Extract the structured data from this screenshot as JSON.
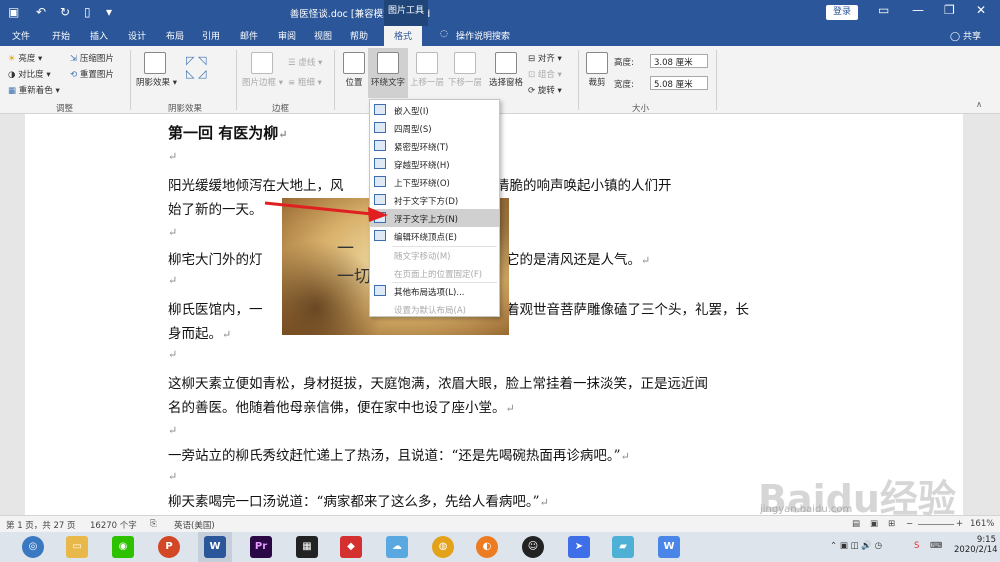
{
  "titlebar": {
    "title": "善医怪谈.doc [兼容模式] - Word",
    "context_tool": "图片工具",
    "login": "登录"
  },
  "tabs": [
    "文件",
    "开始",
    "插入",
    "设计",
    "布局",
    "引用",
    "邮件",
    "审阅",
    "视图",
    "帮助",
    "格式",
    "操作说明搜索",
    "共享"
  ],
  "ribbon": {
    "adjust": {
      "brightness": "亮度",
      "contrast": "对比度",
      "recolor": "重新着色",
      "compress": "压缩图片",
      "reset": "重置图片",
      "group": "调整"
    },
    "shadow": {
      "label": "阴影效果",
      "group": "阴影效果"
    },
    "border": {
      "label": "图片边框",
      "dashes": "虚线",
      "weight": "粗细",
      "group": "边框"
    },
    "arrange": {
      "position": "位置",
      "wrap": "环绕文字",
      "forward": "上移一层",
      "backward": "下移一层",
      "pane": "选择窗格",
      "align": "对齐",
      "group_btn": "组合",
      "rotate": "旋转"
    },
    "size": {
      "crop": "裁剪",
      "height_label": "高度:",
      "height_value": "3.08 厘米",
      "width_label": "宽度:",
      "width_value": "5.08 厘米",
      "group": "大小"
    }
  },
  "document": {
    "heading": "第一回  有医为柳",
    "p1a": "阳光缓缓地倾泻在大地上，风",
    "p1b": "檐下的风竹铃，清脆的响声唤起小镇的人们开",
    "p1c": "始了新的一天。",
    "p2a": "柳宅大门外的灯",
    "p2b": "伴它的是清风还是人气。",
    "p3a": "柳氏医馆内，一",
    "p3b": "对着观世音菩萨雕像磕了三个头，礼罢，长",
    "p3c": "身而起。",
    "p4a": "这柳天素立便如青松，身材挺拔，天庭饱满，浓眉大眼，脸上常挂着一抹淡笑，正是远近闻",
    "p4b": "名的善医。他随着他母亲信佛，便在家中也设了座小堂。",
    "p5": "一旁站立的柳氏秀纹赶忙递上了热汤，且说道：“还是先喝碗热面再诊病吧。”",
    "p6": "柳天素喝完一口汤说道：“病家都来了这么多，先给人看病吧。”",
    "paragraph_mark": "↵",
    "image_text1": "一",
    "image_text2": "一切"
  },
  "wrap_menu": [
    {
      "label": "嵌入型(I)",
      "disabled": false
    },
    {
      "label": "四周型(S)",
      "disabled": false
    },
    {
      "label": "紧密型环绕(T)",
      "disabled": false
    },
    {
      "label": "穿越型环绕(H)",
      "disabled": false
    },
    {
      "label": "上下型环绕(O)",
      "disabled": false
    },
    {
      "label": "衬于文字下方(D)",
      "disabled": false
    },
    {
      "label": "浮于文字上方(N)",
      "disabled": false,
      "highlighted": true
    },
    {
      "label": "编辑环绕顶点(E)",
      "disabled": false
    },
    {
      "label": "随文字移动(M)",
      "disabled": true
    },
    {
      "label": "在页面上的位置固定(F)",
      "disabled": true
    },
    {
      "label": "其他布局选项(L)...",
      "disabled": false
    },
    {
      "label": "设置为默认布局(A)",
      "disabled": true
    }
  ],
  "status": {
    "page": "第 1 页，共 27 页",
    "words": "16270 个字",
    "lang": "英语(美国)",
    "zoom": "161%"
  },
  "taskbar": {
    "time": "9:15",
    "date": "2020/2/14"
  },
  "watermark": {
    "text": "Baidu经验",
    "sub": "jingyan.baidu.com"
  },
  "colors": {
    "titlebar": "#2b579a",
    "highlight": "#d0d0d0",
    "arrow": "#e02020"
  }
}
